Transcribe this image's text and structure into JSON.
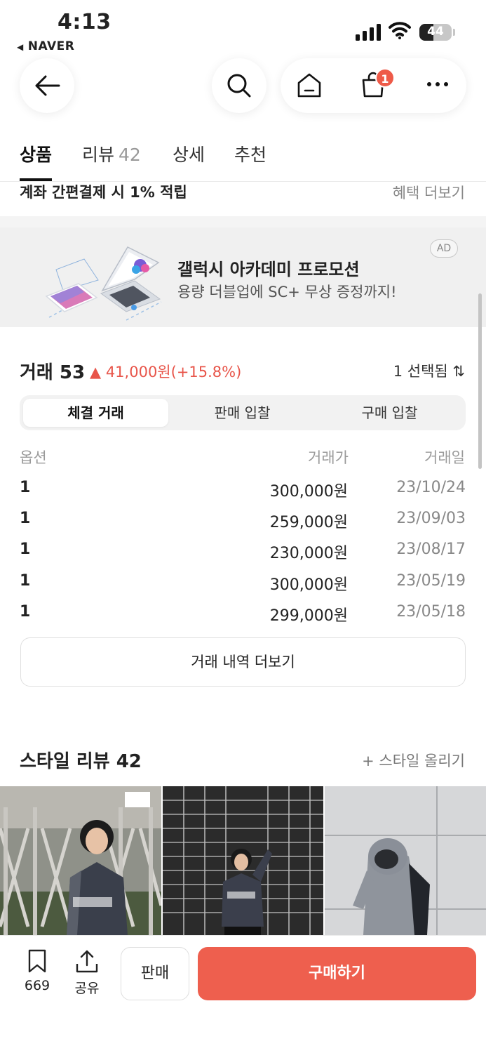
{
  "status_bar": {
    "time": "4:13",
    "back_app": "NAVER",
    "battery_level": "44",
    "battery_fraction": 0.44
  },
  "nav": {
    "cart_badge": "1"
  },
  "tabs": [
    {
      "label": "상품",
      "count": ""
    },
    {
      "label": "리뷰",
      "count": "42"
    },
    {
      "label": "상세",
      "count": ""
    },
    {
      "label": "추천",
      "count": ""
    }
  ],
  "benefit": {
    "text": "계좌 간편결제 시 1% 적립",
    "more": "혜택 더보기"
  },
  "ad": {
    "title": "갤럭시 아카데미 프로모션",
    "subtitle": "용량 더블업에 SC+ 무상 증정까지!",
    "tag": "AD"
  },
  "trade": {
    "title": "거래 53",
    "change": "▲ 41,000원(+15.8%)",
    "selected": "1 선택됨 ⇅",
    "segments": [
      "체결 거래",
      "판매 입찰",
      "구매 입찰"
    ],
    "headers": {
      "option": "옵션",
      "price": "거래가",
      "date": "거래일"
    },
    "rows": [
      {
        "option": "1",
        "price": "300,000원",
        "date": "23/10/24"
      },
      {
        "option": "1",
        "price": "259,000원",
        "date": "23/09/03"
      },
      {
        "option": "1",
        "price": "230,000원",
        "date": "23/08/17"
      },
      {
        "option": "1",
        "price": "300,000원",
        "date": "23/05/19"
      },
      {
        "option": "1",
        "price": "299,000원",
        "date": "23/05/18"
      }
    ],
    "more": "거래 내역 더보기"
  },
  "style_review": {
    "title": "스타일 리뷰 42",
    "upload": "+ 스타일 올리기"
  },
  "bottom": {
    "bookmark_count": "669",
    "share_label": "공유",
    "sell_label": "판매",
    "buy_label": "구매하기"
  },
  "colors": {
    "accent": "#ee5f4e",
    "price_up": "#e8554a"
  }
}
